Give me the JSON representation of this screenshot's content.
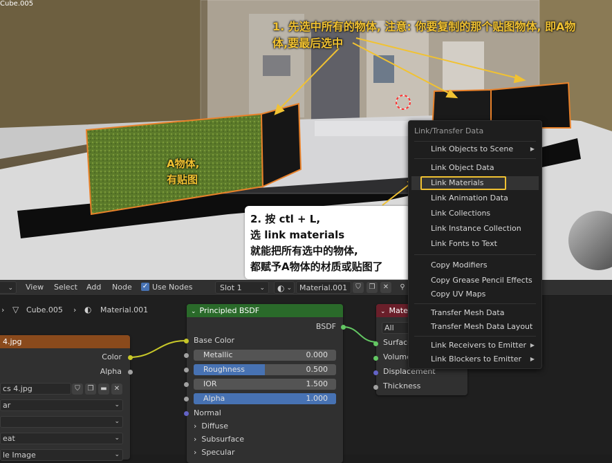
{
  "annotations": {
    "step1_line1": "1. 先选中所有的物体, 注意: 你要复制的那个贴图物体, 即A物",
    "step1_line2": "体,要最后选中",
    "a_object_line1": "A物体,",
    "a_object_line2": "有贴图",
    "step2_lines": [
      "2. 按 ctl + L,",
      "选 link materials",
      "就能把所有选中的物体,",
      "都赋予A物体的材质或贴图了"
    ]
  },
  "viewport": {
    "object_label": "Cube.005"
  },
  "node_editor_header": {
    "menu": [
      "View",
      "Select",
      "Add",
      "Node"
    ],
    "use_nodes_label": "Use Nodes",
    "slot": "Slot 1",
    "material": "Material.001"
  },
  "breadcrumb": {
    "object": "Cube.005",
    "material": "Material.001"
  },
  "image_node": {
    "title": "4.jpg",
    "outputs": [
      "Color",
      "Alpha"
    ],
    "image_name": "cs 4.jpg",
    "dropdowns": [
      "ar",
      "",
      "eat",
      "le Image"
    ]
  },
  "principled_node": {
    "title": "Principled BSDF",
    "output": "BSDF",
    "base_color_label": "Base Color",
    "sliders": [
      {
        "name": "Metallic",
        "value": "0.000",
        "fill": 0,
        "highlight": false
      },
      {
        "name": "Roughness",
        "value": "0.500",
        "fill": 0.5,
        "highlight": false
      },
      {
        "name": "IOR",
        "value": "1.500",
        "fill": 0,
        "highlight": false
      },
      {
        "name": "Alpha",
        "value": "1.000",
        "fill": 1,
        "highlight": true
      }
    ],
    "normal_label": "Normal",
    "panels": [
      "Diffuse",
      "Subsurface",
      "Specular"
    ]
  },
  "output_node": {
    "title": "Mate",
    "target": "All",
    "inputs": [
      "Surface",
      "Volume",
      "Displacement",
      "Thickness"
    ]
  },
  "menu": {
    "title": "Link/Transfer Data",
    "items": [
      {
        "label": "Link Objects to Scene",
        "submenu": true
      },
      {
        "label": "Link Object Data"
      },
      {
        "label": "Link Materials",
        "active": true
      },
      {
        "label": "Link Animation Data"
      },
      {
        "label": "Link Collections"
      },
      {
        "label": "Link Instance Collection"
      },
      {
        "label": "Link Fonts to Text"
      },
      {
        "label": "Copy Modifiers"
      },
      {
        "label": "Copy Grease Pencil Effects"
      },
      {
        "label": "Copy UV Maps"
      },
      {
        "label": "Transfer Mesh Data"
      },
      {
        "label": "Transfer Mesh Data Layout"
      },
      {
        "label": "Link Receivers to Emitter",
        "submenu": true
      },
      {
        "label": "Link Blockers to Emitter",
        "submenu": true
      }
    ]
  },
  "colors": {
    "annotation": "#f1c232",
    "selection_outline": "#e8812a",
    "texture_node_header": "#8a4a1c",
    "shader_node_header": "#2a6a2a",
    "output_node_header": "#6a1f2a",
    "slider_accent": "#4772b3"
  }
}
